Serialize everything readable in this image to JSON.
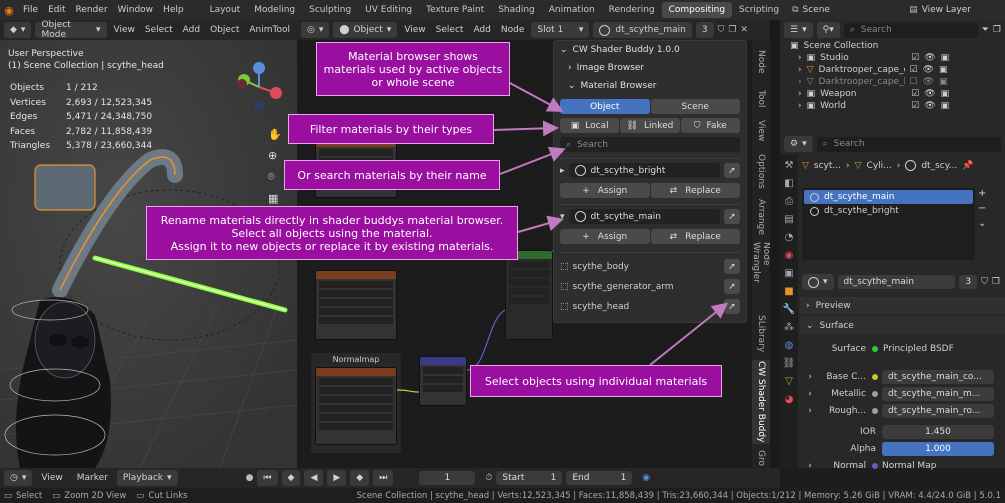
{
  "menu": [
    "File",
    "Edit",
    "Render",
    "Window",
    "Help"
  ],
  "workspaces": [
    "Layout",
    "Modeling",
    "Sculpting",
    "UV Editing",
    "Texture Paint",
    "Shading",
    "Animation",
    "Rendering",
    "Compositing",
    "Scripting"
  ],
  "active_workspace": "Compositing",
  "scene": "Scene",
  "view_layer": "View Layer",
  "viewport": {
    "mode": "Object Mode",
    "menus": [
      "View",
      "Select",
      "Add",
      "Object",
      "AnimTool"
    ],
    "title": "User Perspective",
    "collection": "(1) Scene Collection | scythe_head",
    "stats": [
      {
        "label": "Objects",
        "value": "1 / 212"
      },
      {
        "label": "Vertices",
        "value": "2,693 / 12,523,345"
      },
      {
        "label": "Edges",
        "value": "5,471 / 24,348,750"
      },
      {
        "label": "Faces",
        "value": "2,782 / 11,858,439"
      },
      {
        "label": "Triangles",
        "value": "5,378 / 23,660,344"
      }
    ]
  },
  "node_editor": {
    "type": "Object",
    "menus": [
      "View",
      "Select",
      "Add",
      "Node"
    ],
    "slot": "Slot 1",
    "material": "dt_scythe_main",
    "users": "3",
    "normalmap_title": "Normalmap"
  },
  "shader_panel": {
    "title": "CW Shader Buddy 1.0.0",
    "image_browser": "Image Browser",
    "material_browser": "Material Browser",
    "scope_object": "Object",
    "scope_scene": "Scene",
    "filter_local": "Local",
    "filter_linked": "Linked",
    "filter_fake": "Fake",
    "search_placeholder": "Search",
    "materials": [
      {
        "name": "dt_scythe_bright",
        "expanded": false,
        "assign": "Assign",
        "replace": "Replace"
      },
      {
        "name": "dt_scythe_main",
        "expanded": true,
        "assign": "Assign",
        "replace": "Replace"
      }
    ],
    "objects": [
      "scythe_body",
      "scythe_generator_arm",
      "scythe_head"
    ]
  },
  "callouts": {
    "browser": "Material browser shows materials used by active objects or whole scene",
    "filter": "Filter materials by their types",
    "search": "Or search materials by their name",
    "rename_1": "Rename materials directly in shader buddys material browser.",
    "rename_2": "Select all objects using the material.",
    "rename_3": "Assign it to new objects or replace it by existing materials.",
    "select": "Select objects using individual materials"
  },
  "sidebar_tabs": [
    "Node",
    "Tool",
    "View",
    "Options",
    "Arrange",
    "Node Wrangler",
    "SLibrary",
    "CW Shader Buddy",
    "Gro"
  ],
  "outliner": {
    "search_placeholder": "Search",
    "root": "Scene Collection",
    "items": [
      "Studio",
      "Darktrooper_cape_con",
      "Darktrooper_cape_hoc",
      "Weapon",
      "World"
    ]
  },
  "properties": {
    "search_placeholder": "Search",
    "breadcrumb": [
      "scyt...",
      "Cyli...",
      "dt_scy..."
    ],
    "slots": [
      "dt_scythe_main",
      "dt_scythe_bright"
    ],
    "material": "dt_scythe_main",
    "users": "3",
    "preview": "Preview",
    "surface_section": "Surface",
    "surface_label": "Surface",
    "surface_value": "Principled BSDF",
    "base_color_label": "Base C...",
    "base_color_value": "dt_scythe_main_co...",
    "metallic_label": "Metallic",
    "metallic_value": "dt_scythe_main_m...",
    "roughness_label": "Rough...",
    "roughness_value": "dt_scythe_main_ro...",
    "ior_label": "IOR",
    "ior_value": "1.450",
    "alpha_label": "Alpha",
    "alpha_value": "1.000",
    "normal_label": "Normal",
    "normal_value": "Normal Map"
  },
  "timeline": {
    "menus": [
      "View",
      "Marker",
      "Playback"
    ],
    "frame": "1",
    "start_label": "Start",
    "start": "1",
    "end_label": "End",
    "end": "1"
  },
  "status": {
    "select": "Select",
    "zoom": "Zoom 2D View",
    "cut": "Cut Links",
    "info": "Scene Collection | scythe_head | Verts:12,523,345 | Faces:11,858,439 | Tris:23,660,344 | Objects:1/212 | Memory: 5.26 GiB | VRAM: 4.4/24.0 GiB | 5.0.1"
  },
  "colors": {
    "accent": "#4673c0",
    "callout": "#9a0fa0",
    "header": "#2b2b2b"
  }
}
